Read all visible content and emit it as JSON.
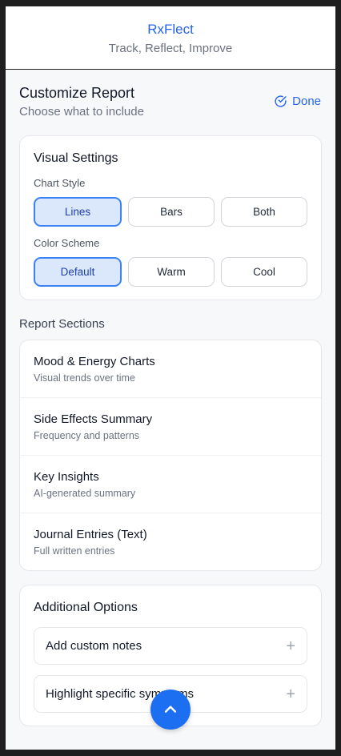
{
  "header": {
    "title": "RxFlect",
    "tagline": "Track, Reflect, Improve"
  },
  "customize": {
    "title": "Customize Report",
    "subtitle": "Choose what to include",
    "done_label": "Done"
  },
  "visual_settings": {
    "title": "Visual Settings",
    "chart_style": {
      "label": "Chart Style",
      "options": [
        "Lines",
        "Bars",
        "Both"
      ],
      "selected": "Lines"
    },
    "color_scheme": {
      "label": "Color Scheme",
      "options": [
        "Default",
        "Warm",
        "Cool"
      ],
      "selected": "Default"
    }
  },
  "report_sections": {
    "label": "Report Sections",
    "items": [
      {
        "title": "Mood & Energy Charts",
        "subtitle": "Visual trends over time"
      },
      {
        "title": "Side Effects Summary",
        "subtitle": "Frequency and patterns"
      },
      {
        "title": "Key Insights",
        "subtitle": "AI-generated summary"
      },
      {
        "title": "Journal Entries (Text)",
        "subtitle": "Full written entries"
      }
    ]
  },
  "additional_options": {
    "title": "Additional Options",
    "items": [
      {
        "label": "Add custom notes",
        "icon": "plus-icon"
      },
      {
        "label": "Highlight specific symptoms",
        "icon": "plus-icon"
      }
    ]
  },
  "fab": {
    "icon": "chevron-up-icon"
  },
  "colors": {
    "accent": "#2563eb",
    "selected_bg": "#dbe7fb",
    "selected_border": "#3b82f6",
    "fab": "#1d6ff2"
  }
}
